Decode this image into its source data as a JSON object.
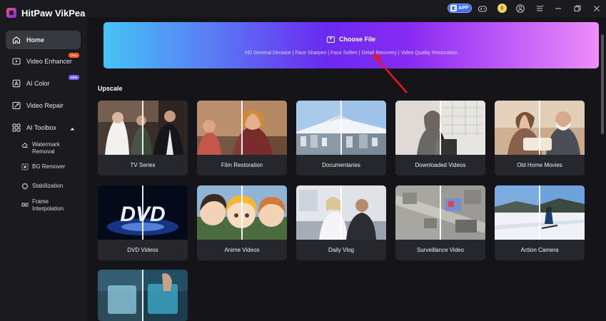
{
  "app": {
    "title": "HitPaw VikPea"
  },
  "titlebar": {
    "app_badge": "APP"
  },
  "sidebar": {
    "items": [
      {
        "label": "Home",
        "icon": "home-icon",
        "active": true
      },
      {
        "label": "Video Enhancer",
        "icon": "video-enhancer-icon",
        "badge": "Pro"
      },
      {
        "label": "AI Color",
        "icon": "palette-icon",
        "badge": "NEW"
      },
      {
        "label": "Video Repair",
        "icon": "repair-icon"
      },
      {
        "label": "AI Toolbox",
        "icon": "toolbox-icon"
      }
    ],
    "toolbox_items": [
      {
        "label": "Watermark Removal",
        "icon": "eraser-icon"
      },
      {
        "label": "BG Remover",
        "icon": "bg-remover-icon"
      },
      {
        "label": "Stabilization",
        "icon": "stabilization-icon"
      },
      {
        "label": "Frame Interpolation",
        "icon": "frame-interpolation-icon"
      }
    ]
  },
  "banner": {
    "choose_file": "Choose File",
    "features": "HD General Denoise | Face Sharpen | Face Soften | Detail Recovery | Video Quality Restoration"
  },
  "section": {
    "title": "Upscale"
  },
  "cards": [
    {
      "label": "TV Series"
    },
    {
      "label": "Film Restoration"
    },
    {
      "label": "Documentaries"
    },
    {
      "label": "Downloaded Videos"
    },
    {
      "label": "Old Home Movies"
    },
    {
      "label": "DVD Videos"
    },
    {
      "label": "Anime Videos"
    },
    {
      "label": "Daily Vlog"
    },
    {
      "label": "Surveillance Video"
    },
    {
      "label": "Action Camera"
    },
    {
      "label": ""
    }
  ],
  "colors": {
    "accent": "#7b2cff",
    "banner_start": "#45c4f5",
    "banner_end": "#ee8ef9",
    "arrow": "#e8132b"
  }
}
